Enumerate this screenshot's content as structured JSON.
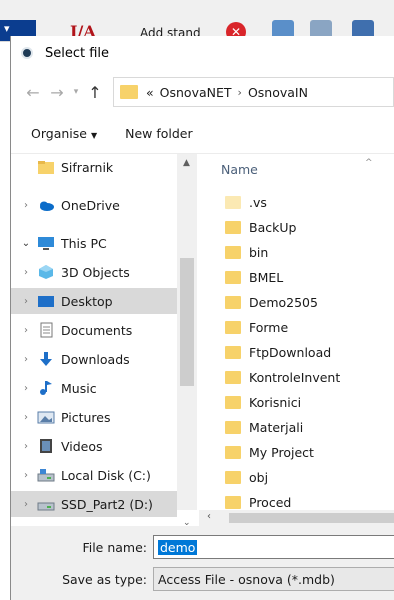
{
  "background_app": {
    "ia_text": "I/A",
    "add_stand": "Add stand"
  },
  "dialog": {
    "title": "Select file"
  },
  "address": {
    "chevron": "«",
    "crumbs": [
      "OsnovaNET",
      "OsnovaIN"
    ]
  },
  "toolbar": {
    "organise": "Organise",
    "new_folder": "New folder"
  },
  "nav_items": [
    {
      "label": "Sifrarnik",
      "icon": "folder-icon"
    },
    {
      "label": "OneDrive",
      "icon": "onedrive-icon"
    },
    {
      "label": "This PC",
      "icon": "computer-icon"
    },
    {
      "label": "3D Objects",
      "icon": "3d-objects-icon"
    },
    {
      "label": "Desktop",
      "icon": "desktop-icon"
    },
    {
      "label": "Documents",
      "icon": "documents-icon"
    },
    {
      "label": "Downloads",
      "icon": "downloads-icon"
    },
    {
      "label": "Music",
      "icon": "music-icon"
    },
    {
      "label": "Pictures",
      "icon": "pictures-icon"
    },
    {
      "label": "Videos",
      "icon": "videos-icon"
    },
    {
      "label": "Local Disk (C:)",
      "icon": "drive-icon"
    },
    {
      "label": "SSD_Part2 (D:)",
      "icon": "drive-icon"
    }
  ],
  "files": {
    "column_name": "Name",
    "items": [
      ".vs",
      "BackUp",
      "bin",
      "BMEL",
      "Demo2505",
      "Forme",
      "FtpDownload",
      "KontroleInvent",
      "Korisnici",
      "Materjali",
      "My Project",
      "obj",
      "Proced"
    ]
  },
  "form": {
    "file_name_label": "File name:",
    "file_name_value": "demo",
    "save_type_label": "Save as type:",
    "save_type_value": "Access File - osnova (*.mdb)"
  },
  "colors": {
    "folder": "#f7d26a",
    "selection": "#d9d9d9",
    "accent": "#0078d7"
  }
}
